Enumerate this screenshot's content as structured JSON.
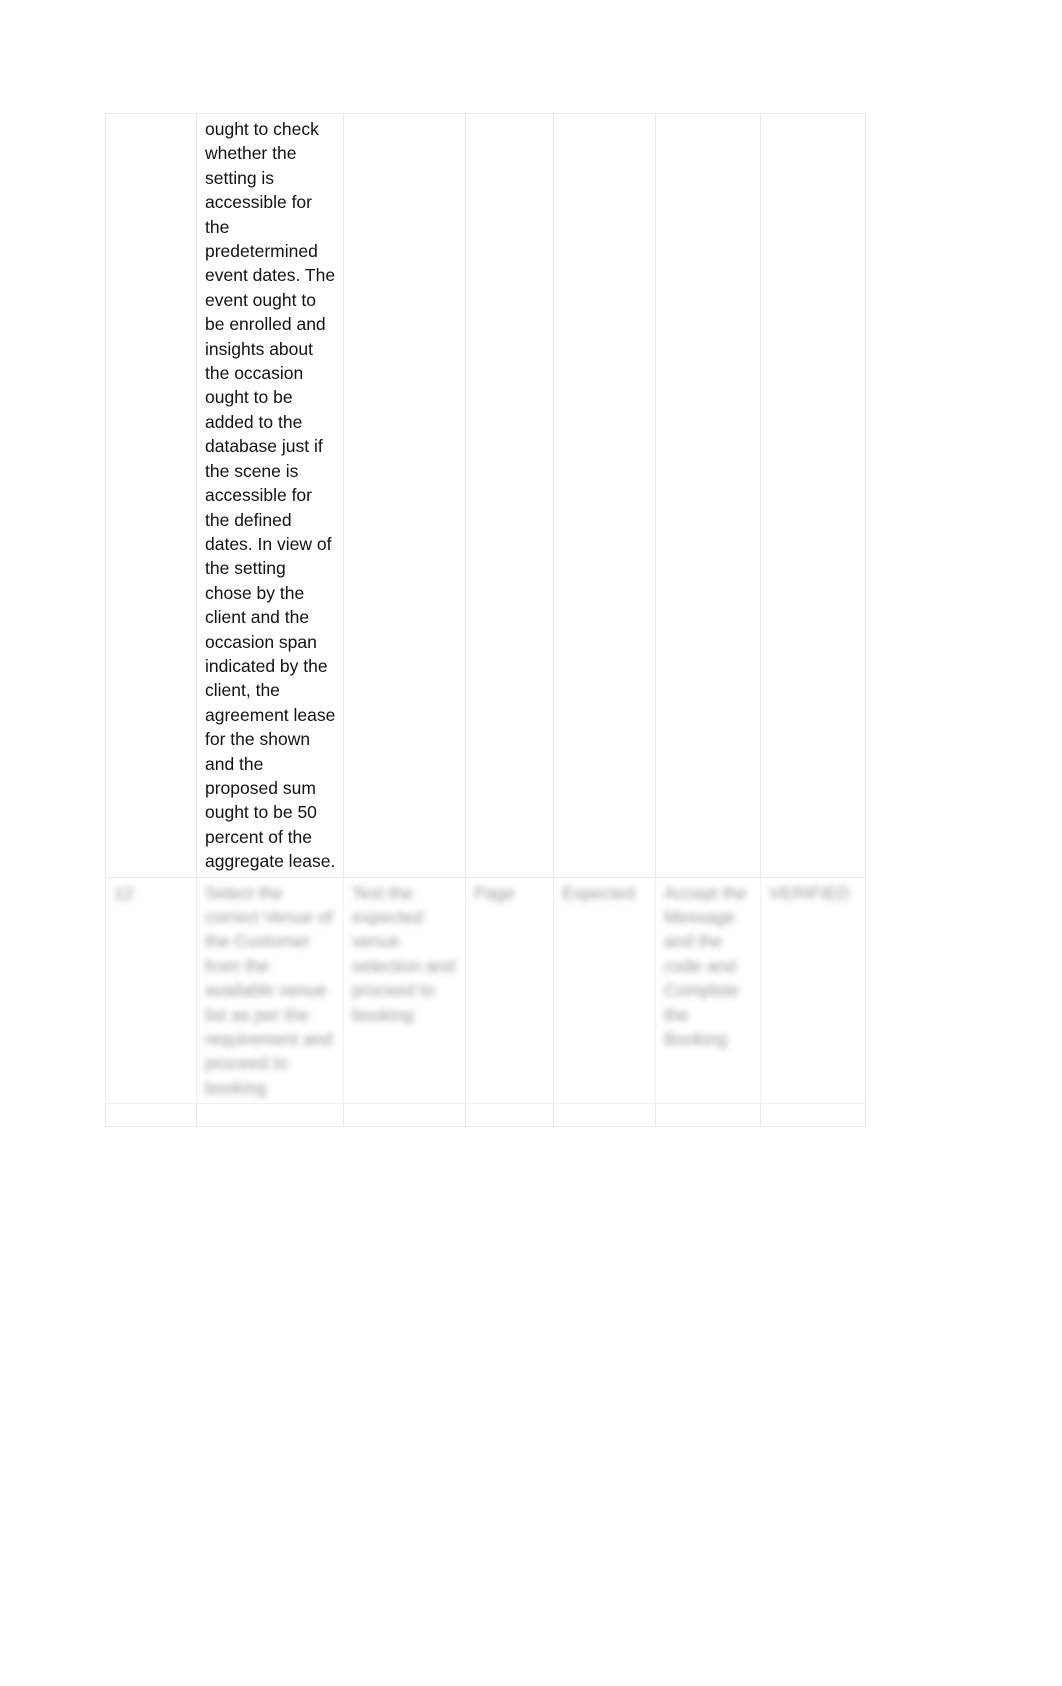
{
  "document": {
    "page_background": "#ffffff",
    "table_border_color": "#e8e8e8",
    "text_color": "#121212"
  },
  "table": {
    "column_count": 7,
    "rows": [
      {
        "name": "main-content-row",
        "redacted": false,
        "cells": [
          "",
          "ought to check whether the setting is accessible for the predetermined event dates. The event ought to be enrolled and insights about the occasion ought to be added to the database just if the scene is accessible for the defined dates. In view of the setting chose by the client and the occasion span indicated by the client, the agreement lease for the shown and the proposed sum ought to be 50 percent of the aggregate lease.",
          "",
          "",
          "",
          "",
          ""
        ]
      },
      {
        "name": "redacted-row",
        "redacted": true,
        "cells": [
          "12",
          "Select the correct Venue of the Customer from the available venue list as per the requirement and proceed to booking",
          "Test the expected venue selection and proceed to booking",
          "Page",
          "Expected",
          "Accept the Message and the code and Complete the Booking",
          "VERIFIED"
        ]
      },
      {
        "name": "spacer-row",
        "redacted": false,
        "cells": [
          "",
          "",
          "",
          "",
          "",
          "",
          ""
        ]
      }
    ]
  }
}
